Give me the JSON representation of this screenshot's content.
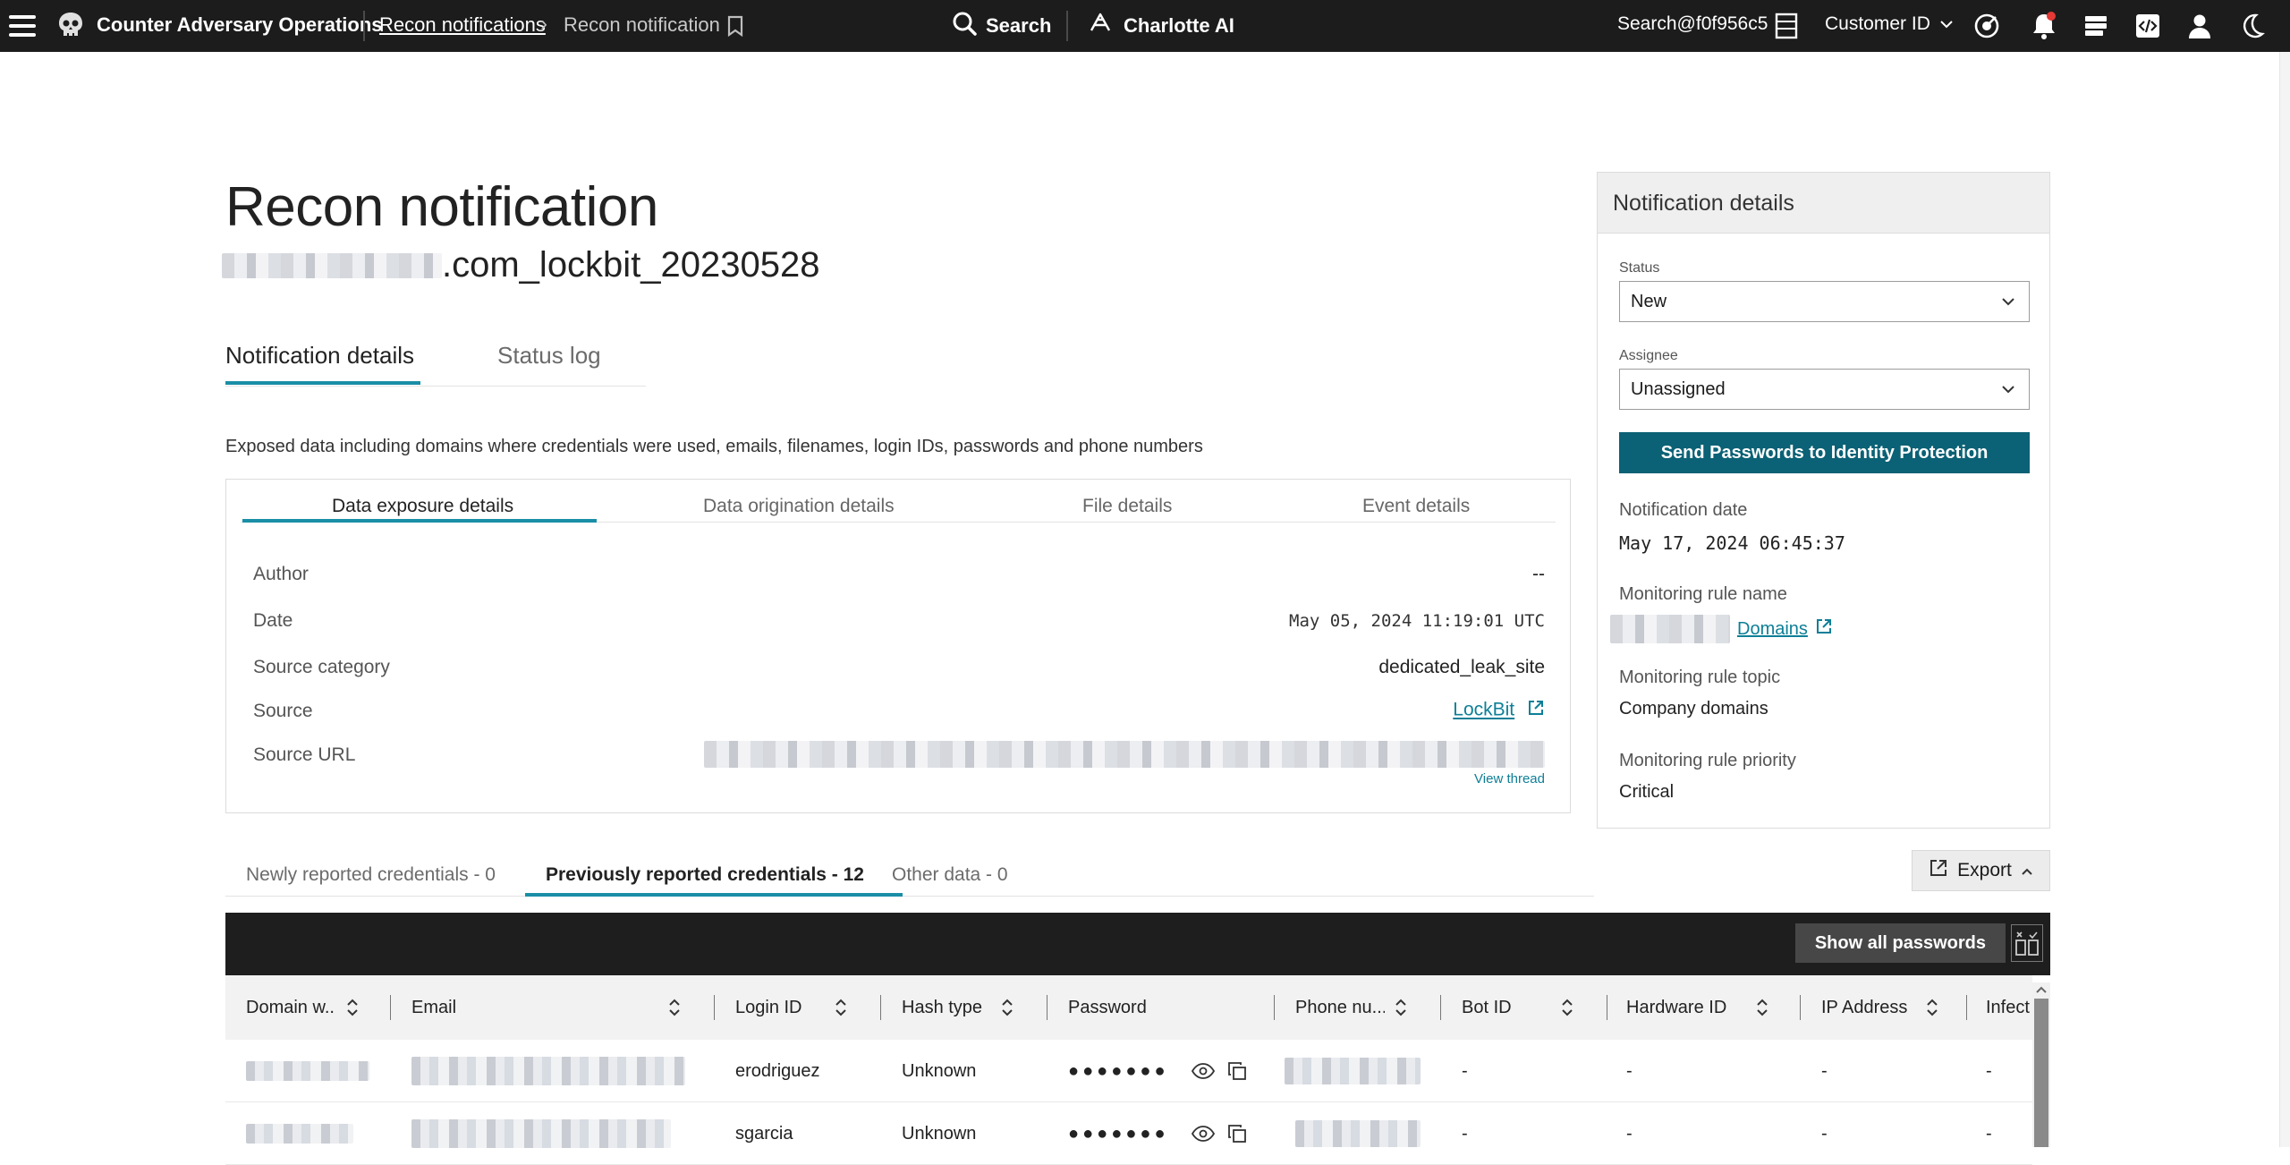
{
  "topbar": {
    "app_title": "Counter Adversary Operations",
    "breadcrumb_link": "Recon notifications",
    "breadcrumb_sep": "›",
    "breadcrumb_current": "Recon notification",
    "search_label": "Search",
    "charlotte_label": "Charlotte AI",
    "user_email": "Search@f0f956c5",
    "customer_id_label": "Customer ID",
    "icons": [
      "menu-icon",
      "skull-logo-icon",
      "bookmark-icon",
      "search-icon",
      "charlotte-icon",
      "cid-card-icon",
      "chevron-down-icon",
      "radar-icon",
      "bell-icon",
      "stack-icon",
      "code-icon",
      "user-icon",
      "moon-icon"
    ]
  },
  "page": {
    "title": "Recon notification",
    "notification_name_suffix": ".com_lockbit_20230528",
    "tabs": [
      {
        "label": "Notification details",
        "active": true
      },
      {
        "label": "Status log",
        "active": false
      }
    ],
    "description": "Exposed data including domains where credentials were used, emails, filenames, login IDs, passwords and phone numbers"
  },
  "details": {
    "tabs": [
      "Data exposure details",
      "Data origination details",
      "File details",
      "Event details"
    ],
    "active_tab": "Data exposure details",
    "rows": [
      {
        "label": "Author",
        "value": "--"
      },
      {
        "label": "Date",
        "value": "May 05, 2024 11:19:01 UTC"
      },
      {
        "label": "Source category",
        "value": "dedicated_leak_site"
      },
      {
        "label": "Source",
        "value": "LockBit"
      },
      {
        "label": "Source URL",
        "value": ""
      }
    ],
    "view_thread": "View thread"
  },
  "panel": {
    "heading": "Notification details",
    "status_label": "Status",
    "status_value": "New",
    "assignee_label": "Assignee",
    "assignee_value": "Unassigned",
    "send_button": "Send Passwords to Identity Protection",
    "notification_date_label": "Notification date",
    "notification_date_value": "May 17, 2024 06:45:37",
    "rule_name_label": "Monitoring rule name",
    "rule_name_link": "Domains",
    "rule_topic_label": "Monitoring rule topic",
    "rule_topic_value": "Company domains",
    "rule_priority_label": "Monitoring rule priority",
    "rule_priority_value": "Critical"
  },
  "credentials": {
    "tabs": [
      {
        "label": "Newly reported credentials - 0",
        "active": false
      },
      {
        "label": "Previously reported credentials - 12",
        "active": true
      },
      {
        "label": "Other data - 0",
        "active": false
      }
    ],
    "export_label": "Export",
    "show_all_passwords": "Show all passwords",
    "columns": [
      "Domain w...",
      "Email",
      "Login ID",
      "Hash type",
      "Password",
      "Phone nu...",
      "Bot ID",
      "Hardware ID",
      "IP Address",
      "Infect"
    ],
    "rows": [
      {
        "login_id": "erodriguez",
        "hash_type": "Unknown",
        "password": "●●●●●●●",
        "bot_id": "-",
        "hardware_id": "-",
        "ip_address": "-",
        "infected": "-"
      },
      {
        "login_id": "sgarcia",
        "hash_type": "Unknown",
        "password": "●●●●●●●",
        "bot_id": "-",
        "hardware_id": "-",
        "ip_address": "-",
        "infected": "-"
      }
    ]
  },
  "colors": {
    "topbar_bg": "#1c1c1c",
    "accent_teal": "#1a8ea6",
    "primary_button": "#0b6175",
    "link": "#0d7f97",
    "notification_dot": "#e53935"
  }
}
